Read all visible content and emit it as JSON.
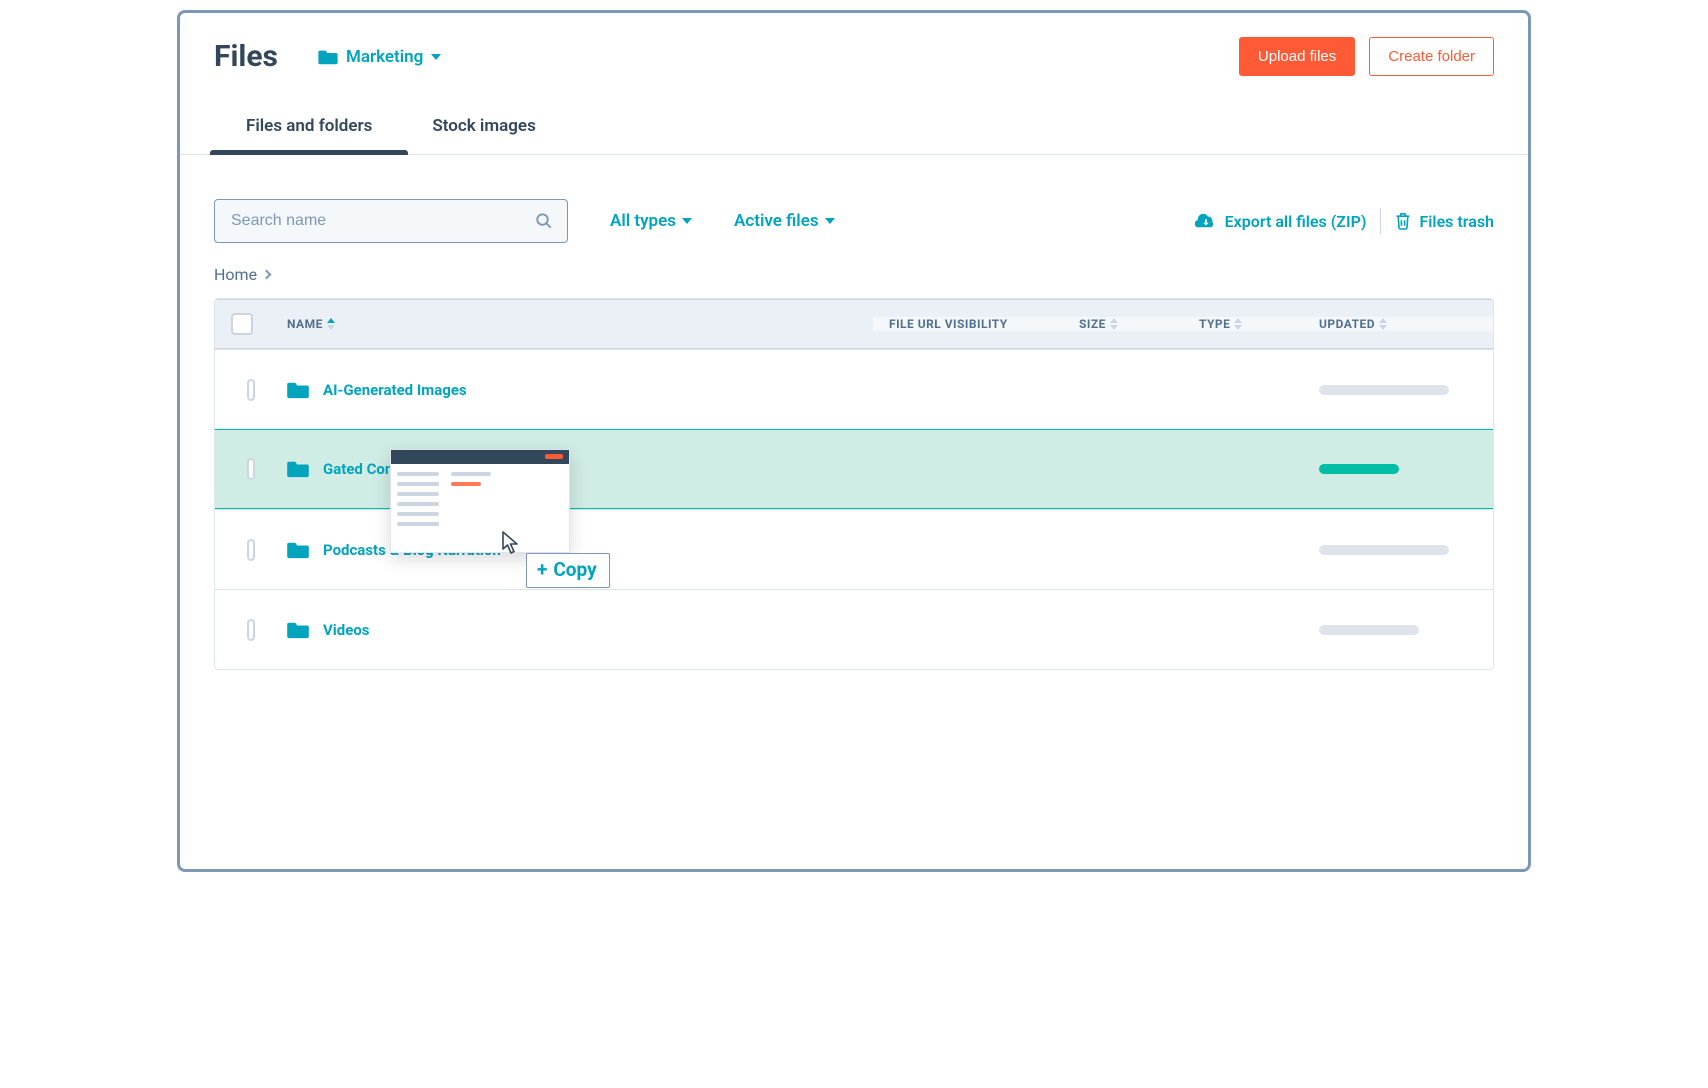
{
  "page": {
    "title": "Files"
  },
  "folder_picker": {
    "label": "Marketing"
  },
  "buttons": {
    "upload": "Upload files",
    "create_folder": "Create folder"
  },
  "tabs": [
    {
      "id": "files",
      "label": "Files and folders",
      "active": true
    },
    {
      "id": "stock",
      "label": "Stock images",
      "active": false
    }
  ],
  "search": {
    "placeholder": "Search name"
  },
  "filters": {
    "types": "All types",
    "status": "Active files"
  },
  "actions": {
    "export": "Export all files (ZIP)",
    "trash": "Files trash"
  },
  "breadcrumb": {
    "root": "Home"
  },
  "columns": {
    "name": "NAME",
    "visibility": "FILE URL VISIBILITY",
    "size": "SIZE",
    "type": "TYPE",
    "updated": "UPDATED"
  },
  "rows": [
    {
      "name": "AI-Generated Images",
      "highlight": false
    },
    {
      "name": "Gated Cont",
      "highlight": true
    },
    {
      "name": "Podcasts & Blog Narration",
      "highlight": false
    },
    {
      "name": "Videos",
      "highlight": false
    }
  ],
  "drag": {
    "tooltip_prefix": "+",
    "tooltip_label": "Copy"
  },
  "colors": {
    "teal": "#00a4bd",
    "orange": "#ff5a36",
    "dark": "#33475b"
  }
}
